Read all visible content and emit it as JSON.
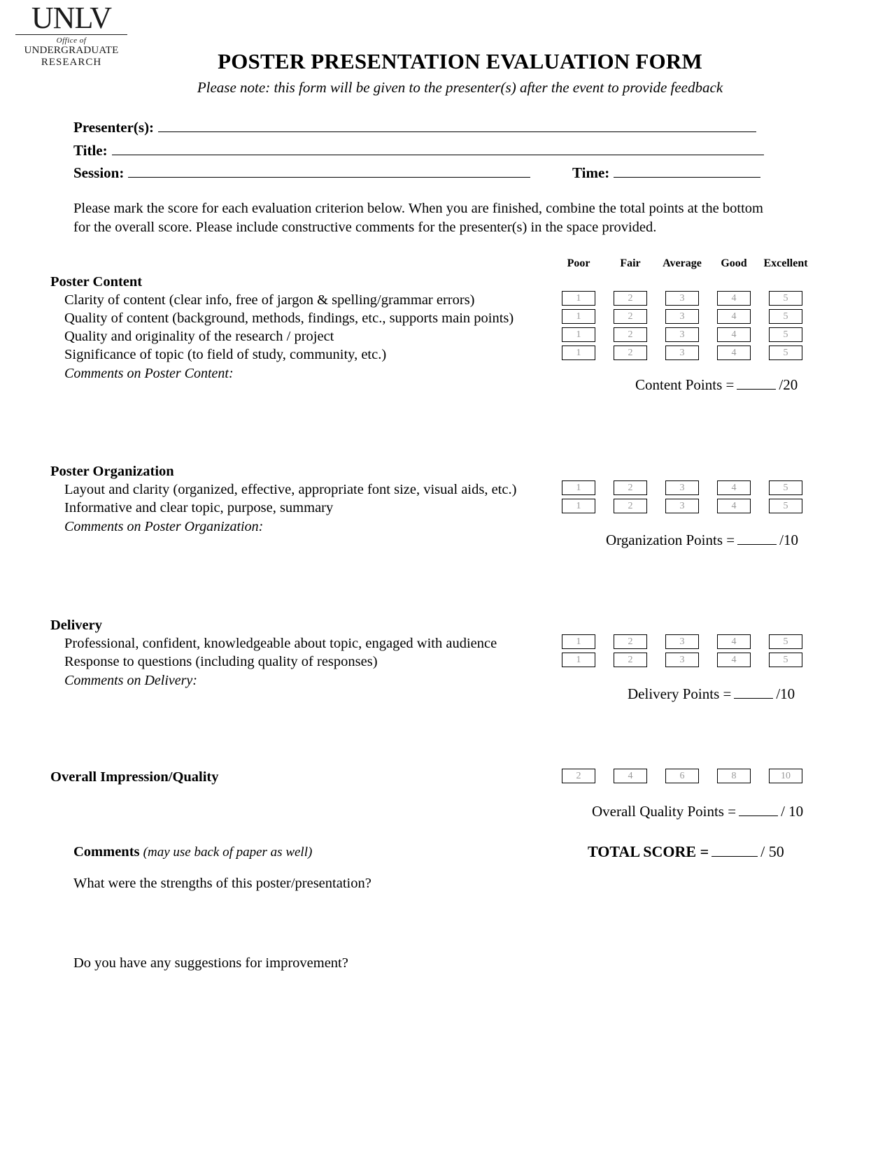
{
  "logo": {
    "line1": "UNLV",
    "line2": "Office of",
    "line3": "UNDERGRADUATE",
    "line4": "RESEARCH"
  },
  "header": {
    "title": "POSTER PRESENTATION EVALUATION FORM",
    "subtitle": "Please note: this form will be given to the presenter(s) after the event to provide feedback"
  },
  "fields": {
    "presenter_label": "Presenter(s):",
    "title_label": "Title:",
    "session_label": "Session:",
    "time_label": "Time:",
    "presenter_value": "",
    "title_value": "",
    "session_value": "",
    "time_value": ""
  },
  "instructions": "Please mark the score for each evaluation criterion below. When you are finished, combine the total points at the bottom for the overall score. Please include constructive comments for the presenter(s) in the space provided.",
  "scale_headers": [
    "Poor",
    "Fair",
    "Average",
    "Good",
    "Excellent"
  ],
  "scale_values": [
    "1",
    "2",
    "3",
    "4",
    "5"
  ],
  "overall_scale_values": [
    "2",
    "4",
    "6",
    "8",
    "10"
  ],
  "sections": [
    {
      "title": "Poster Content",
      "criteria": [
        "Clarity of content (clear info, free of jargon & spelling/grammar errors)",
        "Quality of content (background, methods, findings, etc., supports main points)",
        "Quality and originality of the research / project",
        "Significance of topic (to field of study, community, etc.)"
      ],
      "comments_label": "Comments on Poster Content:",
      "points_label": "Content Points =",
      "points_max": "/20",
      "points_value": ""
    },
    {
      "title": "Poster Organization",
      "criteria": [
        "Layout and clarity (organized, effective, appropriate font size, visual aids, etc.)",
        "Informative and clear topic, purpose, summary"
      ],
      "comments_label": "Comments on Poster Organization:",
      "points_label": "Organization Points =",
      "points_max": "/10",
      "points_value": ""
    },
    {
      "title": "Delivery",
      "criteria": [
        "Professional, confident, knowledgeable about topic, engaged with audience",
        "Response to questions (including quality of responses)"
      ],
      "comments_label": "Comments on Delivery:",
      "points_label": "Delivery Points =",
      "points_max": "/10",
      "points_value": ""
    }
  ],
  "overall": {
    "title": "Overall Impression/Quality",
    "points_label": "Overall Quality Points =",
    "points_max": "/ 10",
    "points_value": ""
  },
  "bottom": {
    "comments_label": "Comments",
    "comments_note": "(may use back of paper as well)",
    "total_label": "TOTAL SCORE =",
    "total_max": "/ 50",
    "total_value": "",
    "question_1": "What were the strengths of this poster/presentation?",
    "question_2": "Do you have any suggestions for improvement?"
  }
}
